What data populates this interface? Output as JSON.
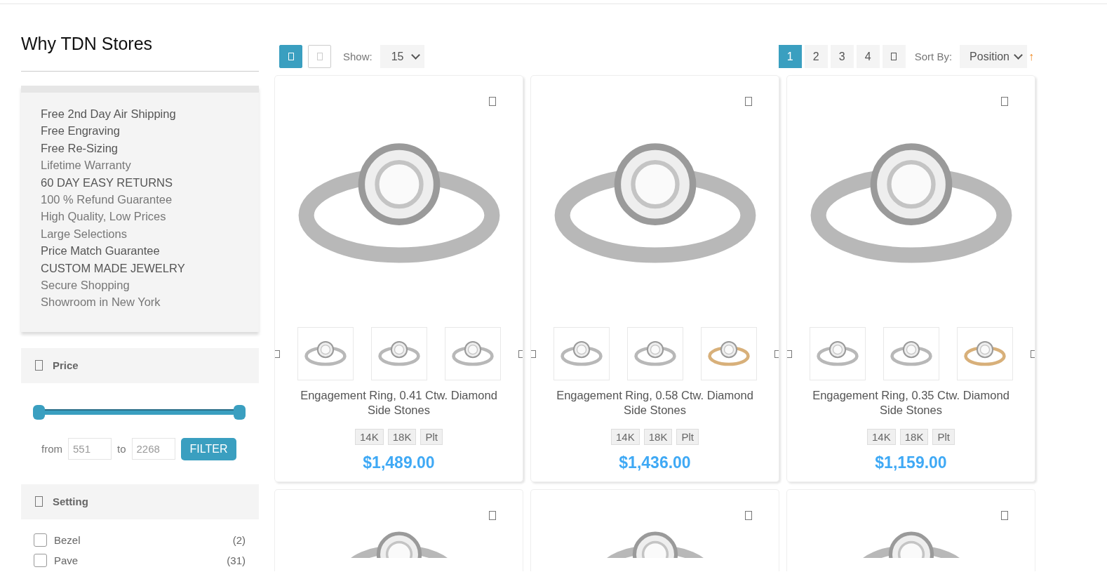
{
  "sidebar": {
    "title": "Why TDN Stores",
    "features": [
      {
        "text": "Free 2nd Day Air Shipping",
        "dark": true
      },
      {
        "text": "Free Engraving",
        "dark": true
      },
      {
        "text": "Free Re-Sizing",
        "dark": true
      },
      {
        "text": "Lifetime Warranty",
        "dark": false
      },
      {
        "text": "60 DAY EASY RETURNS",
        "dark": true
      },
      {
        "text": "100 % Refund Guarantee",
        "dark": false
      },
      {
        "text": "High Quality, Low Prices",
        "dark": false
      },
      {
        "text": "Large Selections",
        "dark": false
      },
      {
        "text": "Price Match Guarantee",
        "dark": true
      },
      {
        "text": "CUSTOM MADE JEWELRY",
        "dark": true
      },
      {
        "text": "Secure Shopping",
        "dark": false
      },
      {
        "text": "Showroom in New York",
        "dark": false
      }
    ],
    "price_filter": {
      "title": "Price",
      "slider": [
        {
          "level": 0
        },
        {
          "level": 1
        }
      ],
      "from_label": "from",
      "from_value": "551",
      "to_label": "to",
      "to_value": "2268",
      "button": "FILTER"
    },
    "setting_filter": {
      "title": "Setting",
      "options": [
        {
          "label": "Bezel",
          "count": "(2)",
          "checked": false
        },
        {
          "label": "Pave",
          "count": "(31)",
          "checked": false
        }
      ]
    }
  },
  "toolbar": {
    "views": [
      {
        "selected": true
      },
      {
        "selected": false
      }
    ],
    "show_label": "Show:",
    "show_value": "15",
    "pages": [
      {
        "label": "1",
        "selected": true
      },
      {
        "label": "2",
        "selected": false
      },
      {
        "label": "3",
        "selected": false
      },
      {
        "label": "4",
        "selected": false
      }
    ],
    "sort_label": "Sort By:",
    "sort_value": "Position",
    "sort_direction": "↑"
  },
  "products": [
    {
      "kind": "full",
      "title": "Engagement Ring, 0.41 Ctw. Diamond Side Stones",
      "metals": [
        "14K",
        "18K",
        "Plt"
      ],
      "price": "$1,489.00",
      "thumbnails": [
        {
          "kind": "white"
        },
        {
          "kind": "white"
        },
        {
          "kind": "white"
        }
      ]
    },
    {
      "kind": "full",
      "title": "Engagement Ring, 0.58 Ctw. Diamond Side Stones",
      "metals": [
        "14K",
        "18K",
        "Plt"
      ],
      "price": "$1,436.00",
      "thumbnails": [
        {
          "kind": "white"
        },
        {
          "kind": "white"
        },
        {
          "kind": "gold"
        }
      ]
    },
    {
      "kind": "full",
      "title": "Engagement Ring, 0.35 Ctw. Diamond Side Stones",
      "metals": [
        "14K",
        "18K",
        "Plt"
      ],
      "price": "$1,159.00",
      "thumbnails": [
        {
          "kind": "white"
        },
        {
          "kind": "white"
        },
        {
          "kind": "gold"
        }
      ]
    },
    {
      "kind": "cut"
    },
    {
      "kind": "cut"
    },
    {
      "kind": "cut"
    }
  ]
}
